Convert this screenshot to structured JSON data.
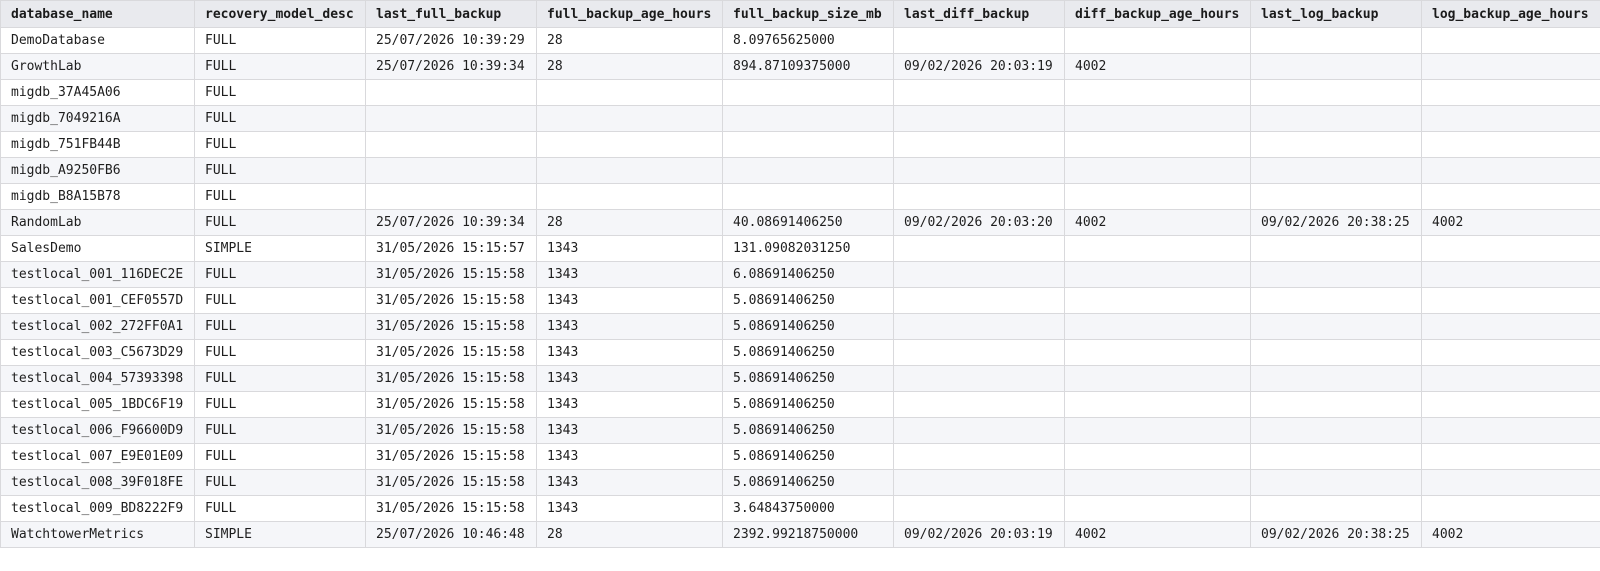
{
  "grid": {
    "columns": [
      "database_name",
      "recovery_model_desc",
      "last_full_backup",
      "full_backup_age_hours",
      "full_backup_size_mb",
      "last_diff_backup",
      "diff_backup_age_hours",
      "last_log_backup",
      "log_backup_age_hours"
    ],
    "rows": [
      [
        "DemoDatabase",
        "FULL",
        "25/07/2026 10:39:29",
        "28",
        "8.09765625000",
        "",
        "",
        "",
        ""
      ],
      [
        "GrowthLab",
        "FULL",
        "25/07/2026 10:39:34",
        "28",
        "894.87109375000",
        "09/02/2026 20:03:19",
        "4002",
        "",
        ""
      ],
      [
        "migdb_37A45A06",
        "FULL",
        "",
        "",
        "",
        "",
        "",
        "",
        ""
      ],
      [
        "migdb_7049216A",
        "FULL",
        "",
        "",
        "",
        "",
        "",
        "",
        ""
      ],
      [
        "migdb_751FB44B",
        "FULL",
        "",
        "",
        "",
        "",
        "",
        "",
        ""
      ],
      [
        "migdb_A9250FB6",
        "FULL",
        "",
        "",
        "",
        "",
        "",
        "",
        ""
      ],
      [
        "migdb_B8A15B78",
        "FULL",
        "",
        "",
        "",
        "",
        "",
        "",
        ""
      ],
      [
        "RandomLab",
        "FULL",
        "25/07/2026 10:39:34",
        "28",
        "40.08691406250",
        "09/02/2026 20:03:20",
        "4002",
        "09/02/2026 20:38:25",
        "4002"
      ],
      [
        "SalesDemo",
        "SIMPLE",
        "31/05/2026 15:15:57",
        "1343",
        "131.09082031250",
        "",
        "",
        "",
        ""
      ],
      [
        "testlocal_001_116DEC2E",
        "FULL",
        "31/05/2026 15:15:58",
        "1343",
        "6.08691406250",
        "",
        "",
        "",
        ""
      ],
      [
        "testlocal_001_CEF0557D",
        "FULL",
        "31/05/2026 15:15:58",
        "1343",
        "5.08691406250",
        "",
        "",
        "",
        ""
      ],
      [
        "testlocal_002_272FF0A1",
        "FULL",
        "31/05/2026 15:15:58",
        "1343",
        "5.08691406250",
        "",
        "",
        "",
        ""
      ],
      [
        "testlocal_003_C5673D29",
        "FULL",
        "31/05/2026 15:15:58",
        "1343",
        "5.08691406250",
        "",
        "",
        "",
        ""
      ],
      [
        "testlocal_004_57393398",
        "FULL",
        "31/05/2026 15:15:58",
        "1343",
        "5.08691406250",
        "",
        "",
        "",
        ""
      ],
      [
        "testlocal_005_1BDC6F19",
        "FULL",
        "31/05/2026 15:15:58",
        "1343",
        "5.08691406250",
        "",
        "",
        "",
        ""
      ],
      [
        "testlocal_006_F96600D9",
        "FULL",
        "31/05/2026 15:15:58",
        "1343",
        "5.08691406250",
        "",
        "",
        "",
        ""
      ],
      [
        "testlocal_007_E9E01E09",
        "FULL",
        "31/05/2026 15:15:58",
        "1343",
        "5.08691406250",
        "",
        "",
        "",
        ""
      ],
      [
        "testlocal_008_39F018FE",
        "FULL",
        "31/05/2026 15:15:58",
        "1343",
        "5.08691406250",
        "",
        "",
        "",
        ""
      ],
      [
        "testlocal_009_BD8222F9",
        "FULL",
        "31/05/2026 15:15:58",
        "1343",
        "3.64843750000",
        "",
        "",
        "",
        ""
      ],
      [
        "WatchtowerMetrics",
        "SIMPLE",
        "25/07/2026 10:46:48",
        "28",
        "2392.99218750000",
        "09/02/2026 20:03:19",
        "4002",
        "09/02/2026 20:38:25",
        "4002"
      ]
    ]
  }
}
